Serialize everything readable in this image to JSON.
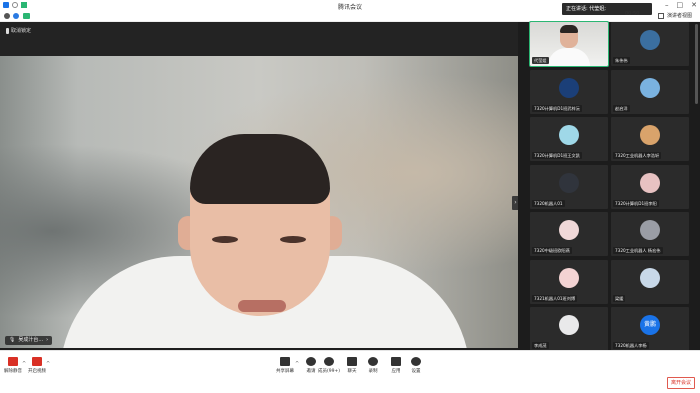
{
  "window": {
    "title": "腾讯会议"
  },
  "subbar": {
    "grid_view": "演讲者视图"
  },
  "speaking": "正在讲话: 代莹姐;",
  "time": "00:50",
  "stage": {
    "mic_label": "取消锁定",
    "speaker_name": "吴成汁台..."
  },
  "participants": [
    {
      "label": "代莹姐",
      "kind": "camera"
    },
    {
      "label": "朱伟伟",
      "kind": "avatar",
      "color": "#3b6fa0"
    },
    {
      "label": "7320计算机D1班武梓沅",
      "kind": "avatar",
      "color": "#1b3f78"
    },
    {
      "label": "赵启洋",
      "kind": "avatar",
      "color": "#7ab2e0"
    },
    {
      "label": "7320计算机D1班王文凯",
      "kind": "avatar",
      "color": "#9fd8e8"
    },
    {
      "label": "7320工业机器人李浩轩",
      "kind": "avatar",
      "color": "#d9a36b"
    },
    {
      "label": "7320机器人01",
      "kind": "avatar",
      "color": "#30343c"
    },
    {
      "label": "7320计算机D1班李阳",
      "kind": "avatar",
      "color": "#e8c2c2"
    },
    {
      "label": "7320中级班欧阳燕",
      "kind": "avatar",
      "color": "#f0d8d8"
    },
    {
      "label": "7320工业机器人 杨宏伟",
      "kind": "avatar",
      "color": "#9a9da5"
    },
    {
      "label": "7321机器人01班刘博",
      "kind": "avatar",
      "color": "#f3d3d3"
    },
    {
      "label": "梁媛",
      "kind": "avatar",
      "color": "#c8d8e8"
    },
    {
      "label": "李成茂",
      "kind": "avatar",
      "color": "#e9e9ea"
    },
    {
      "label": "7320机器人李杨",
      "kind": "initials",
      "initials": "黄鹏",
      "color": "#1a73e8"
    },
    {
      "label": "",
      "kind": "avatar",
      "color": "#c9a27a"
    },
    {
      "label": "",
      "kind": "avatar",
      "color": "#d7d7d7"
    }
  ],
  "toolbar": {
    "mute": "解除静音",
    "video": "开启视频",
    "share": "共享屏幕",
    "invite": "邀请",
    "members": "成员(99+)",
    "chat": "聊天",
    "record": "录制",
    "apps": "应用",
    "settings": "设置",
    "leave": "离开会议"
  }
}
